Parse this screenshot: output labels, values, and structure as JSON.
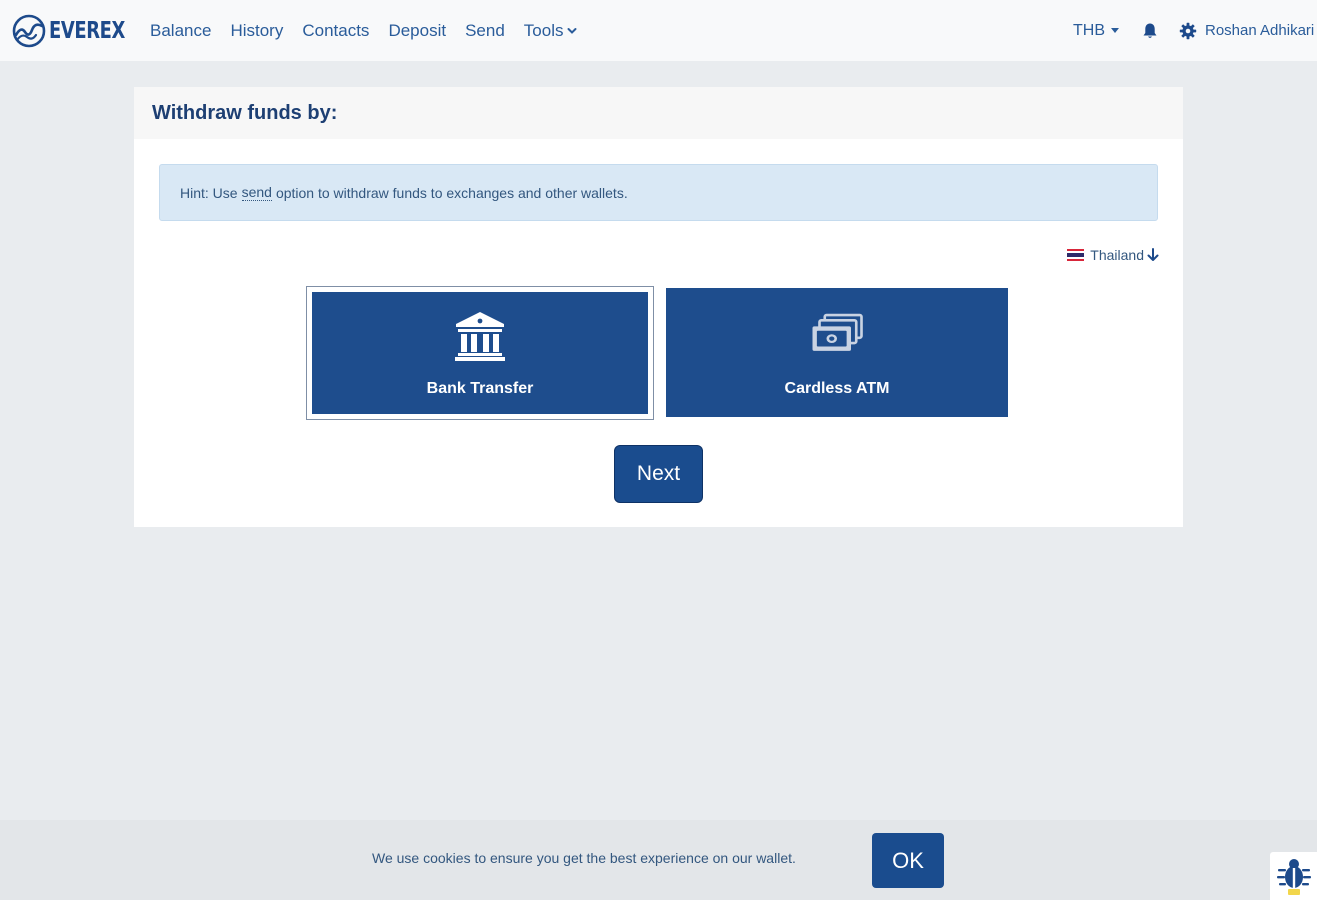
{
  "brand": {
    "name": "EVEREX",
    "logo_icon": "everex-wave-logo-icon"
  },
  "nav": {
    "links": [
      "Balance",
      "History",
      "Contacts",
      "Deposit",
      "Send"
    ],
    "tools_label": "Tools",
    "currency": "THB",
    "username": "Roshan Adhikari"
  },
  "page": {
    "title": "Withdraw funds by:",
    "hint_before": "Hint: Use",
    "hint_link": "send",
    "hint_after": "option to withdraw funds to exchanges and other wallets.",
    "country": "Thailand",
    "options": [
      {
        "label": "Bank Transfer",
        "icon": "bank-icon",
        "selected": true
      },
      {
        "label": "Cardless ATM",
        "icon": "money-stack-icon",
        "selected": false
      }
    ],
    "next_label": "Next"
  },
  "cookie": {
    "text": "We use cookies to ensure you get the best experience on our wallet.",
    "ok_label": "OK"
  },
  "colors": {
    "primary": "#1e4d8d",
    "nav_bg": "#f8f9fa",
    "page_bg": "#e9ecef",
    "hint_bg": "#d9e8f5"
  }
}
